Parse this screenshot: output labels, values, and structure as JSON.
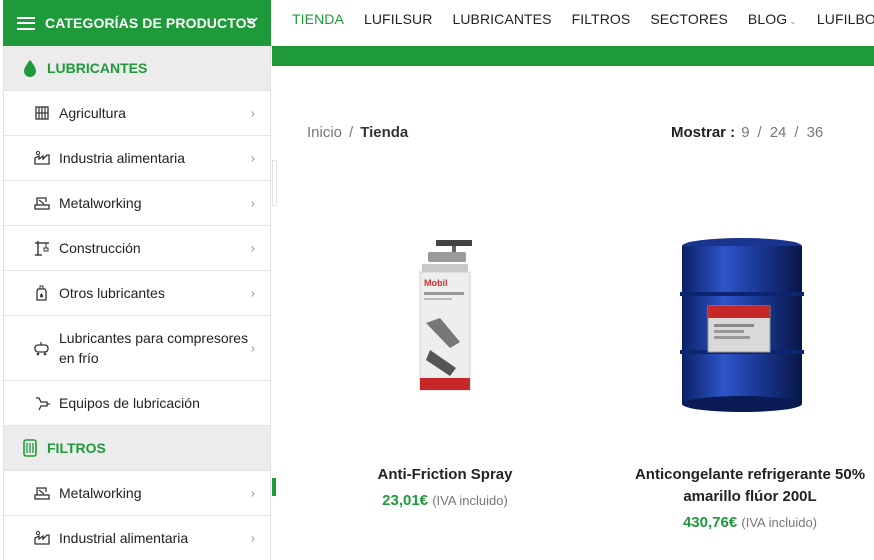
{
  "header": {
    "categories_title": "CATEGORÍAS DE PRODUCTOS",
    "nav": [
      "TIENDA",
      "LUFILSUR",
      "LUBRICANTES",
      "FILTROS",
      "SECTORES",
      "BLOG",
      "LUFILBOOKS"
    ],
    "nav_active": "TIENDA",
    "accent": "#1e9a3b"
  },
  "sidebar": {
    "sections": [
      {
        "title": "LUBRICANTES",
        "icon": "drop-icon",
        "items": [
          {
            "label": "Agricultura",
            "icon": "tractor-icon"
          },
          {
            "label": "Industria alimentaria",
            "icon": "food-industry-icon"
          },
          {
            "label": "Metalworking",
            "icon": "metalworking-icon"
          },
          {
            "label": "Construcción",
            "icon": "construction-icon"
          },
          {
            "label": "Otros lubricantes",
            "icon": "oil-can-icon"
          },
          {
            "label": "Lubricantes para compresores en frío",
            "icon": "compressor-icon"
          },
          {
            "label": "Equipos de lubricación",
            "icon": "grease-gun-icon"
          }
        ]
      },
      {
        "title": "FILTROS",
        "icon": "filter-icon",
        "items": [
          {
            "label": "Metalworking",
            "icon": "metalworking-icon"
          },
          {
            "label": "Industrial alimentaria",
            "icon": "food-industry-icon"
          }
        ]
      }
    ]
  },
  "breadcrumb": {
    "home": "Inicio",
    "separator": "/",
    "current": "Tienda"
  },
  "show": {
    "label": "Mostrar :",
    "options": [
      "9",
      "24",
      "36"
    ],
    "separator": "/"
  },
  "products": [
    {
      "name": "Anti-Friction Spray",
      "price": "23,01€",
      "tax": "(IVA incluido)",
      "image": "spray-can-image"
    },
    {
      "name": "Anticongelante refrigerante 50% amarillo flúor 200L",
      "price": "430,76€",
      "tax": "(IVA incluido)",
      "image": "drum-barrel-image"
    }
  ]
}
